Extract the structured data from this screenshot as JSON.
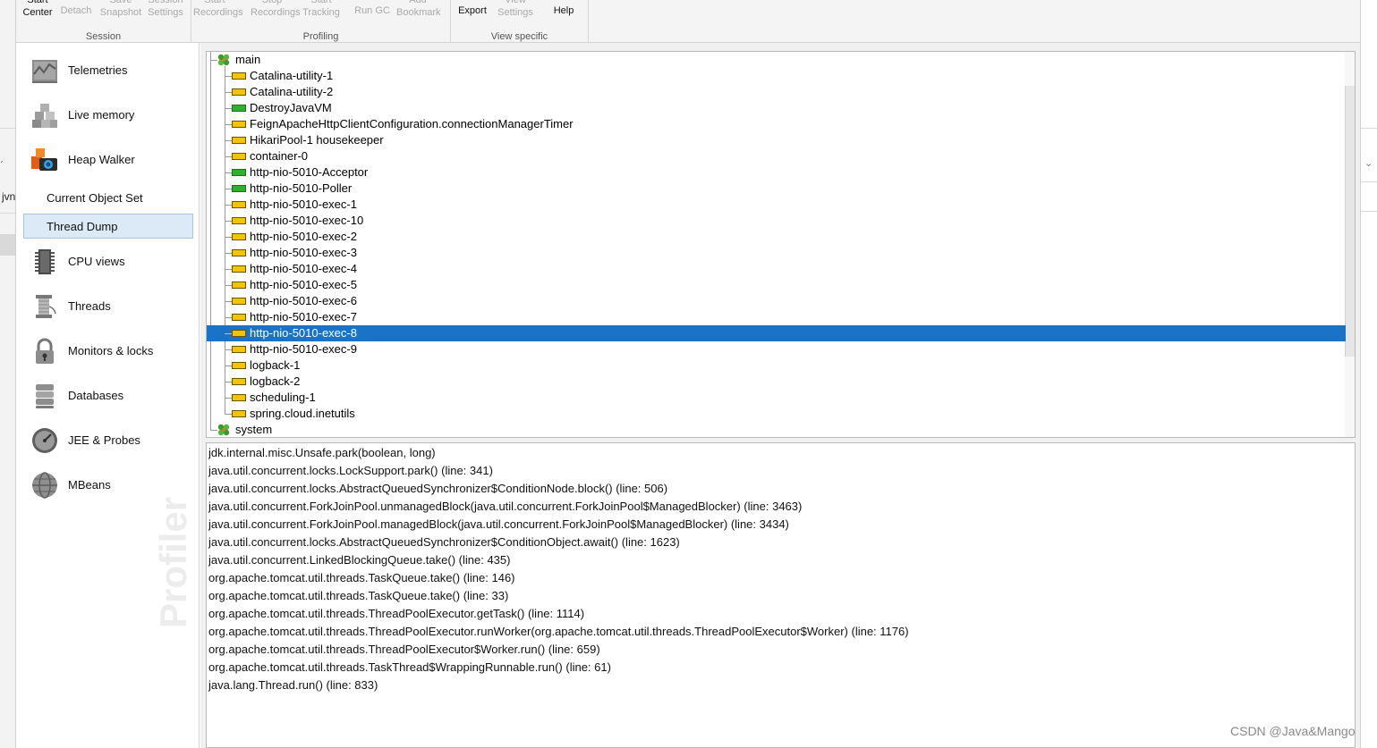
{
  "toolbar": {
    "groups": [
      {
        "label": "Session",
        "buttons": [
          {
            "label": "Start Center",
            "enabled": true
          },
          {
            "label": "Detach",
            "enabled": false
          },
          {
            "label": "Save Snapshot",
            "enabled": false
          },
          {
            "label": "Session Settings",
            "enabled": false
          }
        ]
      },
      {
        "label": "Profiling",
        "buttons": [
          {
            "label": "Start Recordings",
            "enabled": false
          },
          {
            "label": "Stop Recordings",
            "enabled": false
          },
          {
            "label": "Start Tracking",
            "enabled": false
          },
          {
            "label": "Run GC",
            "enabled": false
          },
          {
            "label": "Add Bookmark",
            "enabled": false
          }
        ]
      },
      {
        "label": "View specific",
        "buttons": [
          {
            "label": "Export",
            "enabled": true
          },
          {
            "label": "View Settings",
            "enabled": false
          },
          {
            "label": "Help",
            "enabled": true
          }
        ]
      }
    ]
  },
  "sidebar": {
    "items": [
      {
        "label": "Telemetries",
        "icon": "telemetries-icon"
      },
      {
        "label": "Live memory",
        "icon": "live-memory-icon"
      },
      {
        "label": "Heap Walker",
        "icon": "heap-walker-icon"
      },
      {
        "label": "Current Object Set",
        "sub": true
      },
      {
        "label": "Thread Dump",
        "sub": true,
        "selected": true
      },
      {
        "label": "CPU views",
        "icon": "cpu-views-icon"
      },
      {
        "label": "Threads",
        "icon": "threads-icon"
      },
      {
        "label": "Monitors & locks",
        "icon": "monitors-locks-icon"
      },
      {
        "label": "Databases",
        "icon": "databases-icon"
      },
      {
        "label": "JEE & Probes",
        "icon": "jee-probes-icon"
      },
      {
        "label": "MBeans",
        "icon": "mbeans-icon"
      }
    ],
    "watermark": "Profiler"
  },
  "thread_tree": {
    "groups": [
      {
        "name": "main",
        "threads": [
          {
            "name": "Catalina-utility-1",
            "state": "waiting"
          },
          {
            "name": "Catalina-utility-2",
            "state": "waiting"
          },
          {
            "name": "DestroyJavaVM",
            "state": "runnable"
          },
          {
            "name": "FeignApacheHttpClientConfiguration.connectionManagerTimer",
            "state": "waiting"
          },
          {
            "name": "HikariPool-1 housekeeper",
            "state": "waiting"
          },
          {
            "name": "container-0",
            "state": "waiting"
          },
          {
            "name": "http-nio-5010-Acceptor",
            "state": "runnable"
          },
          {
            "name": "http-nio-5010-Poller",
            "state": "runnable"
          },
          {
            "name": "http-nio-5010-exec-1",
            "state": "waiting"
          },
          {
            "name": "http-nio-5010-exec-10",
            "state": "waiting"
          },
          {
            "name": "http-nio-5010-exec-2",
            "state": "waiting"
          },
          {
            "name": "http-nio-5010-exec-3",
            "state": "waiting"
          },
          {
            "name": "http-nio-5010-exec-4",
            "state": "waiting"
          },
          {
            "name": "http-nio-5010-exec-5",
            "state": "waiting"
          },
          {
            "name": "http-nio-5010-exec-6",
            "state": "waiting"
          },
          {
            "name": "http-nio-5010-exec-7",
            "state": "waiting"
          },
          {
            "name": "http-nio-5010-exec-8",
            "state": "waiting",
            "selected": true
          },
          {
            "name": "http-nio-5010-exec-9",
            "state": "waiting"
          },
          {
            "name": "logback-1",
            "state": "waiting"
          },
          {
            "name": "logback-2",
            "state": "waiting"
          },
          {
            "name": "scheduling-1",
            "state": "waiting"
          },
          {
            "name": "spring.cloud.inetutils",
            "state": "waiting"
          }
        ]
      },
      {
        "name": "system",
        "threads": []
      }
    ]
  },
  "stack_trace": [
    "jdk.internal.misc.Unsafe.park(boolean, long)",
    "java.util.concurrent.locks.LockSupport.park() (line: 341)",
    "java.util.concurrent.locks.AbstractQueuedSynchronizer$ConditionNode.block() (line: 506)",
    "java.util.concurrent.ForkJoinPool.unmanagedBlock(java.util.concurrent.ForkJoinPool$ManagedBlocker) (line: 3463)",
    "java.util.concurrent.ForkJoinPool.managedBlock(java.util.concurrent.ForkJoinPool$ManagedBlocker) (line: 3434)",
    "java.util.concurrent.locks.AbstractQueuedSynchronizer$ConditionObject.await() (line: 1623)",
    "java.util.concurrent.LinkedBlockingQueue.take() (line: 435)",
    "org.apache.tomcat.util.threads.TaskQueue.take() (line: 146)",
    "org.apache.tomcat.util.threads.TaskQueue.take() (line: 33)",
    "org.apache.tomcat.util.threads.ThreadPoolExecutor.getTask() (line: 1114)",
    "org.apache.tomcat.util.threads.ThreadPoolExecutor.runWorker(org.apache.tomcat.util.threads.ThreadPoolExecutor$Worker) (line: 1176)",
    "org.apache.tomcat.util.threads.ThreadPoolExecutor$Worker.run() (line: 659)",
    "org.apache.tomcat.util.threads.TaskThread$WrappingRunnable.run() (line: 61)",
    "java.lang.Thread.run() (line: 833)"
  ],
  "background_window": {
    "left_text": "jvn",
    "left_mark": "ˊ"
  },
  "colors": {
    "selection": "#1b73c8",
    "waiting": "#f5c400",
    "runnable": "#2fb12f",
    "sidebar_selected": "#dce9f6"
  },
  "footer_watermark": "CSDN @Java&Mango"
}
